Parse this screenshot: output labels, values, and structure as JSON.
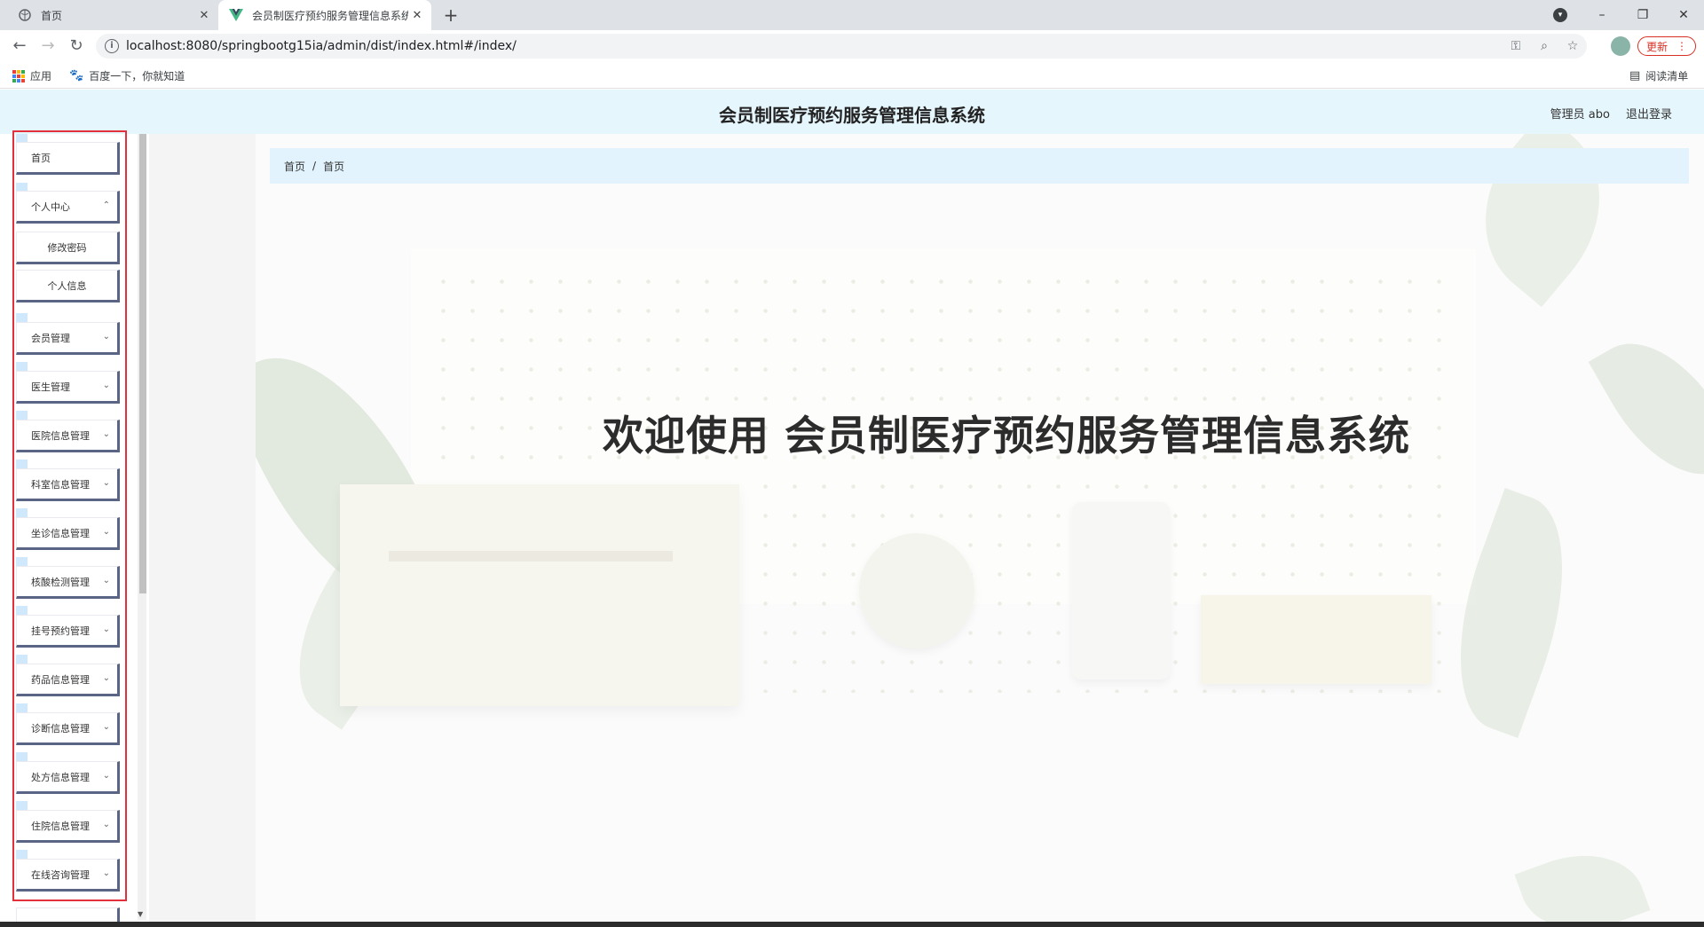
{
  "browser": {
    "tabs": [
      {
        "title": "首页",
        "active": false
      },
      {
        "title": "会员制医疗预约服务管理信息系统",
        "active": true
      }
    ],
    "url": "localhost:8080/springbootg15ia/admin/dist/index.html#/index/",
    "update_label": "更新",
    "bookmarks": {
      "apps": "应用",
      "baidu": "百度一下，你就知道",
      "reading_list": "阅读清单"
    }
  },
  "header": {
    "title": "会员制医疗预约服务管理信息系统",
    "user": "管理员 abo",
    "logout": "退出登录"
  },
  "sidebar": {
    "items": [
      {
        "label": "首页",
        "has_arrow": false
      },
      {
        "label": "个人中心",
        "has_arrow": true
      },
      {
        "label": "修改密码",
        "sub": true
      },
      {
        "label": "个人信息",
        "sub": true
      },
      {
        "label": "会员管理",
        "has_arrow": true
      },
      {
        "label": "医生管理",
        "has_arrow": true
      },
      {
        "label": "医院信息管理",
        "has_arrow": true
      },
      {
        "label": "科室信息管理",
        "has_arrow": true
      },
      {
        "label": "坐诊信息管理",
        "has_arrow": true
      },
      {
        "label": "核酸检测管理",
        "has_arrow": true
      },
      {
        "label": "挂号预约管理",
        "has_arrow": true
      },
      {
        "label": "药品信息管理",
        "has_arrow": true
      },
      {
        "label": "诊断信息管理",
        "has_arrow": true
      },
      {
        "label": "处方信息管理",
        "has_arrow": true
      },
      {
        "label": "住院信息管理",
        "has_arrow": true
      },
      {
        "label": "在线咨询管理",
        "has_arrow": true
      }
    ]
  },
  "breadcrumb": {
    "items": [
      "首页",
      "首页"
    ],
    "separator": "/"
  },
  "main": {
    "welcome": "欢迎使用 会员制医疗预约服务管理信息系统"
  },
  "colors": {
    "header_bg": "#e6f6fd",
    "breadcrumb_bg": "#e2f3fd",
    "menu_shadow": "#5a6485",
    "highlight": "#e3303d"
  }
}
